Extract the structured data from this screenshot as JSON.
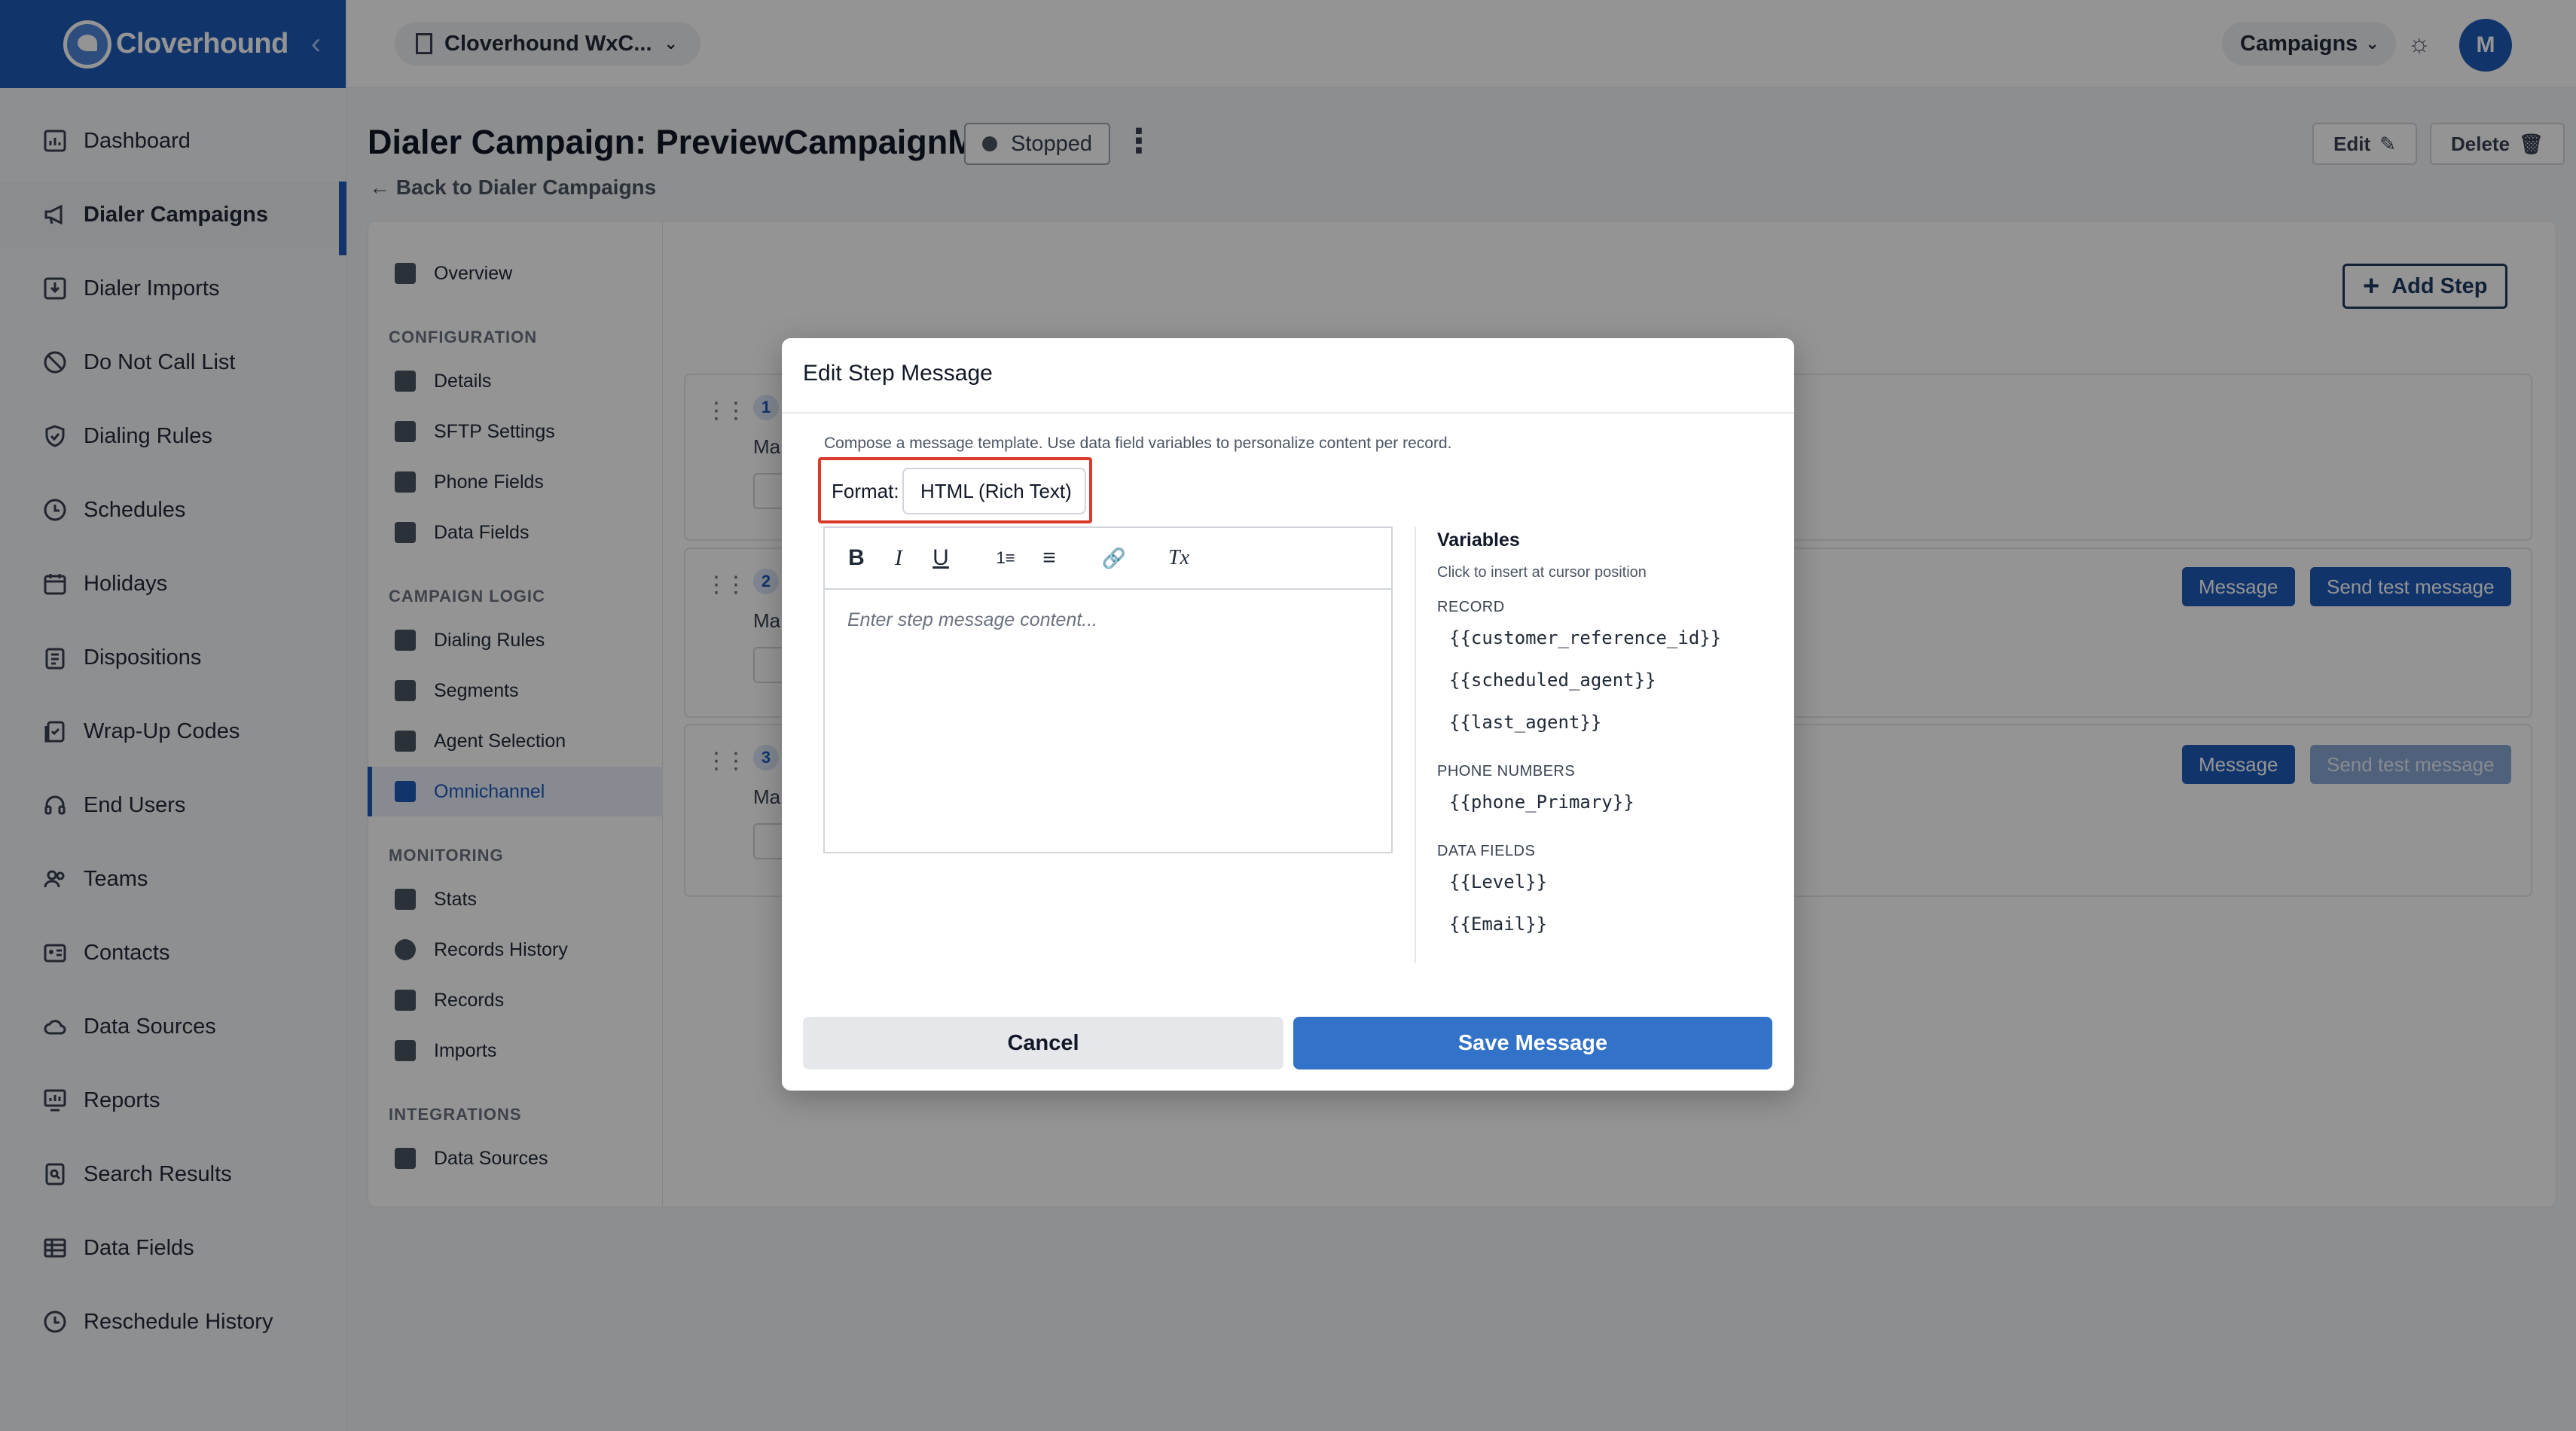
{
  "brand": {
    "name": "Cloverhound",
    "collapse_icon": "chevron-left-icon"
  },
  "topbar": {
    "org": "Cloverhound WxC...",
    "campaigns": "Campaigns",
    "avatar": "M"
  },
  "sidebar": {
    "items": [
      {
        "label": "Dashboard",
        "icon": "dashboard-icon"
      },
      {
        "label": "Dialer Campaigns",
        "icon": "megaphone-icon",
        "active": true
      },
      {
        "label": "Dialer Imports",
        "icon": "import-icon"
      },
      {
        "label": "Do Not Call List",
        "icon": "block-icon"
      },
      {
        "label": "Dialing Rules",
        "icon": "shield-icon"
      },
      {
        "label": "Schedules",
        "icon": "clock-icon"
      },
      {
        "label": "Holidays",
        "icon": "calendar-icon"
      },
      {
        "label": "Dispositions",
        "icon": "clipboard-icon"
      },
      {
        "label": "Wrap-Up Codes",
        "icon": "wrapup-icon"
      },
      {
        "label": "End Users",
        "icon": "headset-icon"
      },
      {
        "label": "Teams",
        "icon": "users-icon"
      },
      {
        "label": "Contacts",
        "icon": "contact-card-icon"
      },
      {
        "label": "Data Sources",
        "icon": "cloud-icon"
      },
      {
        "label": "Reports",
        "icon": "report-icon"
      },
      {
        "label": "Search Results",
        "icon": "search-doc-icon"
      },
      {
        "label": "Data Fields",
        "icon": "table-icon"
      },
      {
        "label": "Reschedule History",
        "icon": "history-icon"
      }
    ]
  },
  "page": {
    "title": "Dialer Campaign: PreviewCampaignM",
    "status": "Stopped",
    "back": "Back to Dialer Campaigns",
    "edit": "Edit",
    "delete": "Delete"
  },
  "subnav": {
    "overview": "Overview",
    "configuration": {
      "heading": "CONFIGURATION",
      "items": [
        "Details",
        "SFTP Settings",
        "Phone Fields",
        "Data Fields"
      ]
    },
    "campaign_logic": {
      "heading": "CAMPAIGN LOGIC",
      "items": [
        "Dialing Rules",
        "Segments",
        "Agent Selection",
        "Omnichannel"
      ]
    },
    "monitoring": {
      "heading": "MONITORING",
      "items": [
        "Stats",
        "Records History",
        "Records",
        "Imports"
      ]
    },
    "integrations": {
      "heading": "INTEGRATIONS",
      "items": [
        "Data Sources"
      ]
    },
    "active": "Omnichannel"
  },
  "steps": {
    "add_label": "Add Step",
    "cards": [
      {
        "num": "1",
        "kind": "Ma"
      },
      {
        "num": "2",
        "kind": "Ma",
        "message": "Message",
        "test": "Send test message"
      },
      {
        "num": "3",
        "kind": "Ma",
        "message": "Message",
        "test": "Send test message",
        "test_disabled": true
      }
    ]
  },
  "modal": {
    "title": "Edit Step Message",
    "description": "Compose a message template. Use data field variables to personalize content per record.",
    "format_label": "Format:",
    "format_value": "HTML (Rich Text)",
    "editor_placeholder": "Enter step message content...",
    "toolbar": {
      "bold": "B",
      "italic": "I",
      "underline": "U",
      "ordered": "1≡",
      "bullets": "≡",
      "link": "🔗",
      "clear": "Tx"
    },
    "variables": {
      "title": "Variables",
      "subtitle": "Click to insert at cursor position",
      "groups": [
        {
          "heading": "RECORD",
          "vars": [
            "{{customer_reference_id}}",
            "{{scheduled_agent}}",
            "{{last_agent}}"
          ]
        },
        {
          "heading": "PHONE NUMBERS",
          "vars": [
            "{{phone_Primary}}"
          ]
        },
        {
          "heading": "DATA FIELDS",
          "vars": [
            "{{Level}}",
            "{{Email}}"
          ]
        }
      ]
    },
    "cancel": "Cancel",
    "save": "Save Message"
  }
}
